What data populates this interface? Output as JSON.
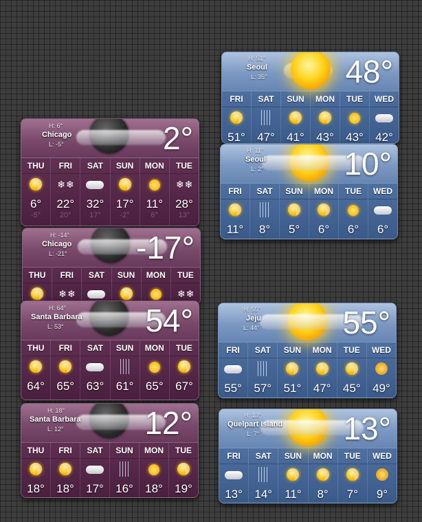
{
  "widgets": {
    "seoul_f": {
      "hi": "H: 51°",
      "city": "Seoul",
      "lo": "L: 35°",
      "temp": "48°",
      "days": [
        "FRI",
        "SAT",
        "SUN",
        "MON",
        "TUE",
        "WED"
      ],
      "highs": [
        "51°",
        "47°",
        "41°",
        "43°",
        "43°",
        "42°"
      ],
      "icons": [
        "partly-sunny-icon",
        "rain-icon",
        "partly-sunny-icon",
        "partly-sunny-icon",
        "sun-icon",
        "cloud-icon"
      ]
    },
    "chicago_f": {
      "hi": "H: 6°",
      "city": "Chicago",
      "lo": "L: -5°",
      "temp": "2°",
      "days": [
        "THU",
        "FRI",
        "SAT",
        "SUN",
        "MON",
        "TUE"
      ],
      "highs": [
        "6°",
        "22°",
        "32°",
        "17°",
        "11°",
        "28°"
      ],
      "lows": [
        "-5°",
        "20°",
        "17°",
        "-2°",
        "6°",
        "13°"
      ],
      "icons": [
        "partly-sunny-icon",
        "snow-icon",
        "cloud-icon",
        "partly-sunny-icon",
        "sun-icon",
        "snow-icon"
      ]
    },
    "seoul_c": {
      "hi": "H: 11°",
      "city": "Seoul",
      "lo": "L: 2°",
      "temp": "10°",
      "days": [
        "FRI",
        "SAT",
        "SUN",
        "MON",
        "TUE",
        "WED"
      ],
      "highs": [
        "11°",
        "8°",
        "5°",
        "6°",
        "6°",
        "6°"
      ],
      "icons": [
        "partly-sunny-icon",
        "rain-icon",
        "partly-sunny-icon",
        "partly-sunny-icon",
        "sun-icon",
        "cloud-icon"
      ]
    },
    "chicago_c": {
      "hi": "H: -14°",
      "city": "Chicago",
      "lo": "L: -21°",
      "temp": "-17°",
      "days": [
        "THU",
        "FRI",
        "SAT",
        "SUN",
        "MON",
        "TUE"
      ],
      "icons": [
        "partly-sunny-icon",
        "snow-icon",
        "cloud-icon",
        "partly-sunny-icon",
        "sun-icon",
        "snow-icon"
      ]
    },
    "sb_f": {
      "hi": "H: 64°",
      "city": "Santa Barbara",
      "lo": "L: 53°",
      "temp": "54°",
      "days": [
        "THU",
        "FRI",
        "SAT",
        "SUN",
        "MON",
        "TUE"
      ],
      "highs": [
        "64°",
        "65°",
        "63°",
        "61°",
        "65°",
        "67°"
      ],
      "icons": [
        "partly-sunny-icon",
        "partly-sunny-icon",
        "cloud-icon",
        "rain-icon",
        "sun-icon",
        "partly-sunny-icon"
      ]
    },
    "jeju_f": {
      "hi": "H: 55°",
      "city": "Jeju",
      "lo": "L: 44°",
      "temp": "55°",
      "days": [
        "FRI",
        "SAT",
        "SUN",
        "MON",
        "TUE",
        "WED"
      ],
      "highs": [
        "55°",
        "57°",
        "51°",
        "47°",
        "45°",
        "49°"
      ],
      "icons": [
        "cloud-icon",
        "rain-icon",
        "partly-sunny-icon",
        "partly-sunny-icon",
        "partly-sunny-icon",
        "sun-rain-icon"
      ]
    },
    "sb_c": {
      "hi": "H: 18°",
      "city": "Santa Barbara",
      "lo": "L: 12°",
      "temp": "12°",
      "days": [
        "THU",
        "FRI",
        "SAT",
        "SUN",
        "MON",
        "TUE"
      ],
      "highs": [
        "18°",
        "18°",
        "17°",
        "16°",
        "18°",
        "19°"
      ],
      "icons": [
        "partly-sunny-icon",
        "partly-sunny-icon",
        "cloud-icon",
        "rain-icon",
        "sun-icon",
        "partly-sunny-icon"
      ]
    },
    "quelpart_c": {
      "hi": "H: 13°",
      "city": "Quelpart Island",
      "lo": "L: 7°",
      "temp": "13°",
      "days": [
        "FRI",
        "SAT",
        "SUN",
        "MON",
        "TUE",
        "WED"
      ],
      "highs": [
        "13°",
        "14°",
        "11°",
        "8°",
        "7°",
        "9°"
      ],
      "icons": [
        "cloud-icon",
        "rain-icon",
        "partly-sunny-icon",
        "partly-sunny-icon",
        "partly-sunny-icon",
        "sun-rain-icon"
      ]
    }
  }
}
